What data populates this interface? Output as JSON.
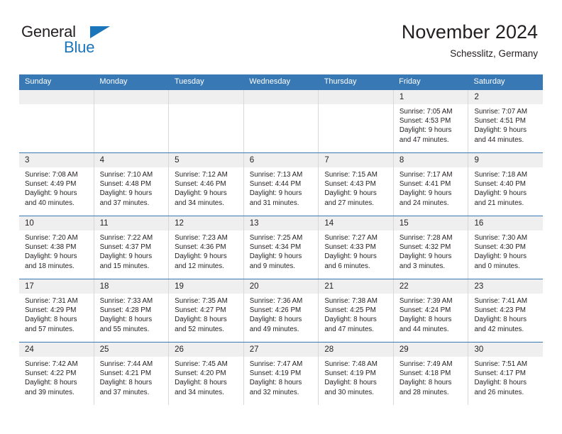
{
  "brand": {
    "name_part1": "General",
    "name_part2": "Blue",
    "triangle_color": "#1b75bb",
    "text_color": "#231f20"
  },
  "header": {
    "title": "November 2024",
    "subtitle": "Schesslitz, Germany"
  },
  "theme": {
    "header_band": "#3878b4",
    "daynum_band": "#efefef",
    "grid_line": "#d8d8d8",
    "text": "#231f20"
  },
  "weekdays": [
    "Sunday",
    "Monday",
    "Tuesday",
    "Wednesday",
    "Thursday",
    "Friday",
    "Saturday"
  ],
  "weeks": [
    [
      {
        "day": "",
        "lines": []
      },
      {
        "day": "",
        "lines": []
      },
      {
        "day": "",
        "lines": []
      },
      {
        "day": "",
        "lines": []
      },
      {
        "day": "",
        "lines": []
      },
      {
        "day": "1",
        "lines": [
          "Sunrise: 7:05 AM",
          "Sunset: 4:53 PM",
          "Daylight: 9 hours",
          "and 47 minutes."
        ]
      },
      {
        "day": "2",
        "lines": [
          "Sunrise: 7:07 AM",
          "Sunset: 4:51 PM",
          "Daylight: 9 hours",
          "and 44 minutes."
        ]
      }
    ],
    [
      {
        "day": "3",
        "lines": [
          "Sunrise: 7:08 AM",
          "Sunset: 4:49 PM",
          "Daylight: 9 hours",
          "and 40 minutes."
        ]
      },
      {
        "day": "4",
        "lines": [
          "Sunrise: 7:10 AM",
          "Sunset: 4:48 PM",
          "Daylight: 9 hours",
          "and 37 minutes."
        ]
      },
      {
        "day": "5",
        "lines": [
          "Sunrise: 7:12 AM",
          "Sunset: 4:46 PM",
          "Daylight: 9 hours",
          "and 34 minutes."
        ]
      },
      {
        "day": "6",
        "lines": [
          "Sunrise: 7:13 AM",
          "Sunset: 4:44 PM",
          "Daylight: 9 hours",
          "and 31 minutes."
        ]
      },
      {
        "day": "7",
        "lines": [
          "Sunrise: 7:15 AM",
          "Sunset: 4:43 PM",
          "Daylight: 9 hours",
          "and 27 minutes."
        ]
      },
      {
        "day": "8",
        "lines": [
          "Sunrise: 7:17 AM",
          "Sunset: 4:41 PM",
          "Daylight: 9 hours",
          "and 24 minutes."
        ]
      },
      {
        "day": "9",
        "lines": [
          "Sunrise: 7:18 AM",
          "Sunset: 4:40 PM",
          "Daylight: 9 hours",
          "and 21 minutes."
        ]
      }
    ],
    [
      {
        "day": "10",
        "lines": [
          "Sunrise: 7:20 AM",
          "Sunset: 4:38 PM",
          "Daylight: 9 hours",
          "and 18 minutes."
        ]
      },
      {
        "day": "11",
        "lines": [
          "Sunrise: 7:22 AM",
          "Sunset: 4:37 PM",
          "Daylight: 9 hours",
          "and 15 minutes."
        ]
      },
      {
        "day": "12",
        "lines": [
          "Sunrise: 7:23 AM",
          "Sunset: 4:36 PM",
          "Daylight: 9 hours",
          "and 12 minutes."
        ]
      },
      {
        "day": "13",
        "lines": [
          "Sunrise: 7:25 AM",
          "Sunset: 4:34 PM",
          "Daylight: 9 hours",
          "and 9 minutes."
        ]
      },
      {
        "day": "14",
        "lines": [
          "Sunrise: 7:27 AM",
          "Sunset: 4:33 PM",
          "Daylight: 9 hours",
          "and 6 minutes."
        ]
      },
      {
        "day": "15",
        "lines": [
          "Sunrise: 7:28 AM",
          "Sunset: 4:32 PM",
          "Daylight: 9 hours",
          "and 3 minutes."
        ]
      },
      {
        "day": "16",
        "lines": [
          "Sunrise: 7:30 AM",
          "Sunset: 4:30 PM",
          "Daylight: 9 hours",
          "and 0 minutes."
        ]
      }
    ],
    [
      {
        "day": "17",
        "lines": [
          "Sunrise: 7:31 AM",
          "Sunset: 4:29 PM",
          "Daylight: 8 hours",
          "and 57 minutes."
        ]
      },
      {
        "day": "18",
        "lines": [
          "Sunrise: 7:33 AM",
          "Sunset: 4:28 PM",
          "Daylight: 8 hours",
          "and 55 minutes."
        ]
      },
      {
        "day": "19",
        "lines": [
          "Sunrise: 7:35 AM",
          "Sunset: 4:27 PM",
          "Daylight: 8 hours",
          "and 52 minutes."
        ]
      },
      {
        "day": "20",
        "lines": [
          "Sunrise: 7:36 AM",
          "Sunset: 4:26 PM",
          "Daylight: 8 hours",
          "and 49 minutes."
        ]
      },
      {
        "day": "21",
        "lines": [
          "Sunrise: 7:38 AM",
          "Sunset: 4:25 PM",
          "Daylight: 8 hours",
          "and 47 minutes."
        ]
      },
      {
        "day": "22",
        "lines": [
          "Sunrise: 7:39 AM",
          "Sunset: 4:24 PM",
          "Daylight: 8 hours",
          "and 44 minutes."
        ]
      },
      {
        "day": "23",
        "lines": [
          "Sunrise: 7:41 AM",
          "Sunset: 4:23 PM",
          "Daylight: 8 hours",
          "and 42 minutes."
        ]
      }
    ],
    [
      {
        "day": "24",
        "lines": [
          "Sunrise: 7:42 AM",
          "Sunset: 4:22 PM",
          "Daylight: 8 hours",
          "and 39 minutes."
        ]
      },
      {
        "day": "25",
        "lines": [
          "Sunrise: 7:44 AM",
          "Sunset: 4:21 PM",
          "Daylight: 8 hours",
          "and 37 minutes."
        ]
      },
      {
        "day": "26",
        "lines": [
          "Sunrise: 7:45 AM",
          "Sunset: 4:20 PM",
          "Daylight: 8 hours",
          "and 34 minutes."
        ]
      },
      {
        "day": "27",
        "lines": [
          "Sunrise: 7:47 AM",
          "Sunset: 4:19 PM",
          "Daylight: 8 hours",
          "and 32 minutes."
        ]
      },
      {
        "day": "28",
        "lines": [
          "Sunrise: 7:48 AM",
          "Sunset: 4:19 PM",
          "Daylight: 8 hours",
          "and 30 minutes."
        ]
      },
      {
        "day": "29",
        "lines": [
          "Sunrise: 7:49 AM",
          "Sunset: 4:18 PM",
          "Daylight: 8 hours",
          "and 28 minutes."
        ]
      },
      {
        "day": "30",
        "lines": [
          "Sunrise: 7:51 AM",
          "Sunset: 4:17 PM",
          "Daylight: 8 hours",
          "and 26 minutes."
        ]
      }
    ]
  ]
}
